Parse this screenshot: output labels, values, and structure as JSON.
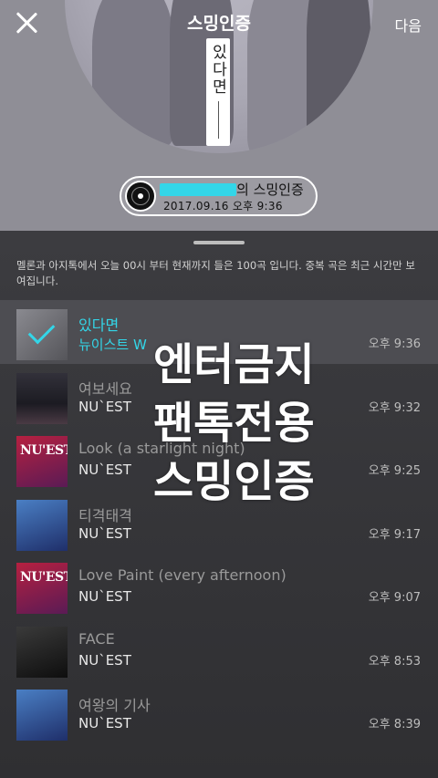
{
  "header": {
    "title": "스밍인증",
    "next_label": "다음",
    "album_card_text": "있다면"
  },
  "certification": {
    "suffix": "의 스밍인증",
    "datetime": "2017.09.16 오후 9:36"
  },
  "notice": "멜론과 아지톡에서 오늘 00시 부터 현재까지 들은 100곡 입니다. 중복 곡은 최근 시간만 보여집니다.",
  "tracks": [
    {
      "name": "있다면",
      "artist": "뉴이스트 W",
      "time": "오후 9:36",
      "selected": true
    },
    {
      "name": "여보세요",
      "artist": "NU`EST",
      "time": "오후 9:32"
    },
    {
      "name": "Look (a starlight night)",
      "artist": "NU`EST",
      "time": "오후 9:25",
      "thumb_text": "NU'EST"
    },
    {
      "name": "티격태격",
      "artist": "NU`EST",
      "time": "오후 9:17"
    },
    {
      "name": "Love Paint (every afternoon)",
      "artist": "NU`EST",
      "time": "오후 9:07",
      "thumb_text": "NU'EST"
    },
    {
      "name": "FACE",
      "artist": "NU`EST",
      "time": "오후 8:53"
    },
    {
      "name": "여왕의 기사",
      "artist": "NU`EST",
      "time": "오후 8:39"
    }
  ],
  "watermark": [
    "엔터금지",
    "팬톡전용",
    "스밍인증"
  ],
  "colors": {
    "accent": "#33d6e8",
    "sheet_bg": "#3a3a3d"
  }
}
